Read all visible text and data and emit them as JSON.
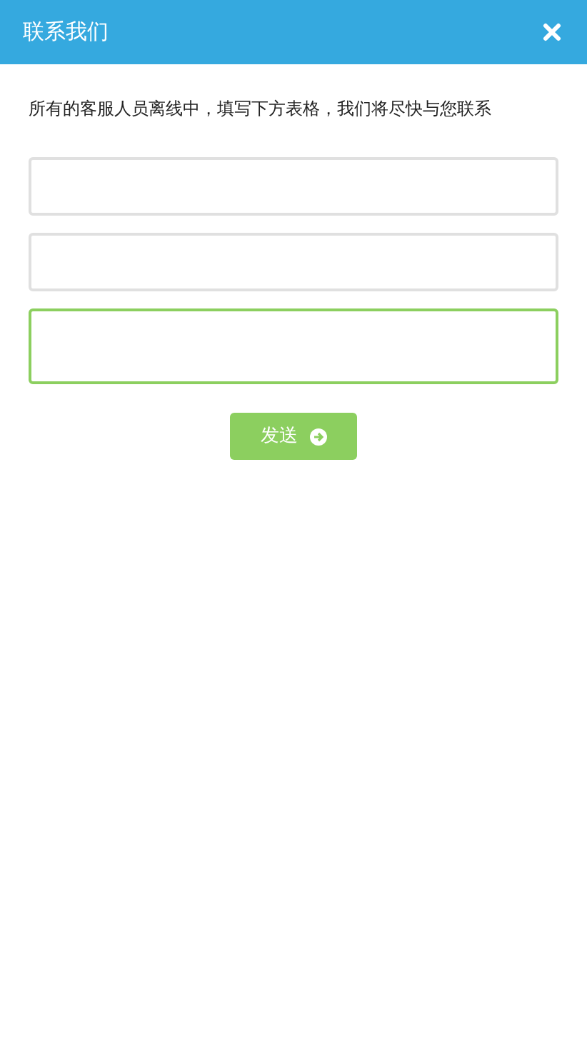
{
  "header": {
    "title": "联系我们"
  },
  "message": "所有的客服人员离线中，填写下方表格，我们将尽快与您联系",
  "fields": [
    {
      "kind": "input",
      "focused": false
    },
    {
      "kind": "input",
      "focused": false
    },
    {
      "kind": "textarea",
      "focused": true
    }
  ],
  "send_button": {
    "label": "发送"
  }
}
